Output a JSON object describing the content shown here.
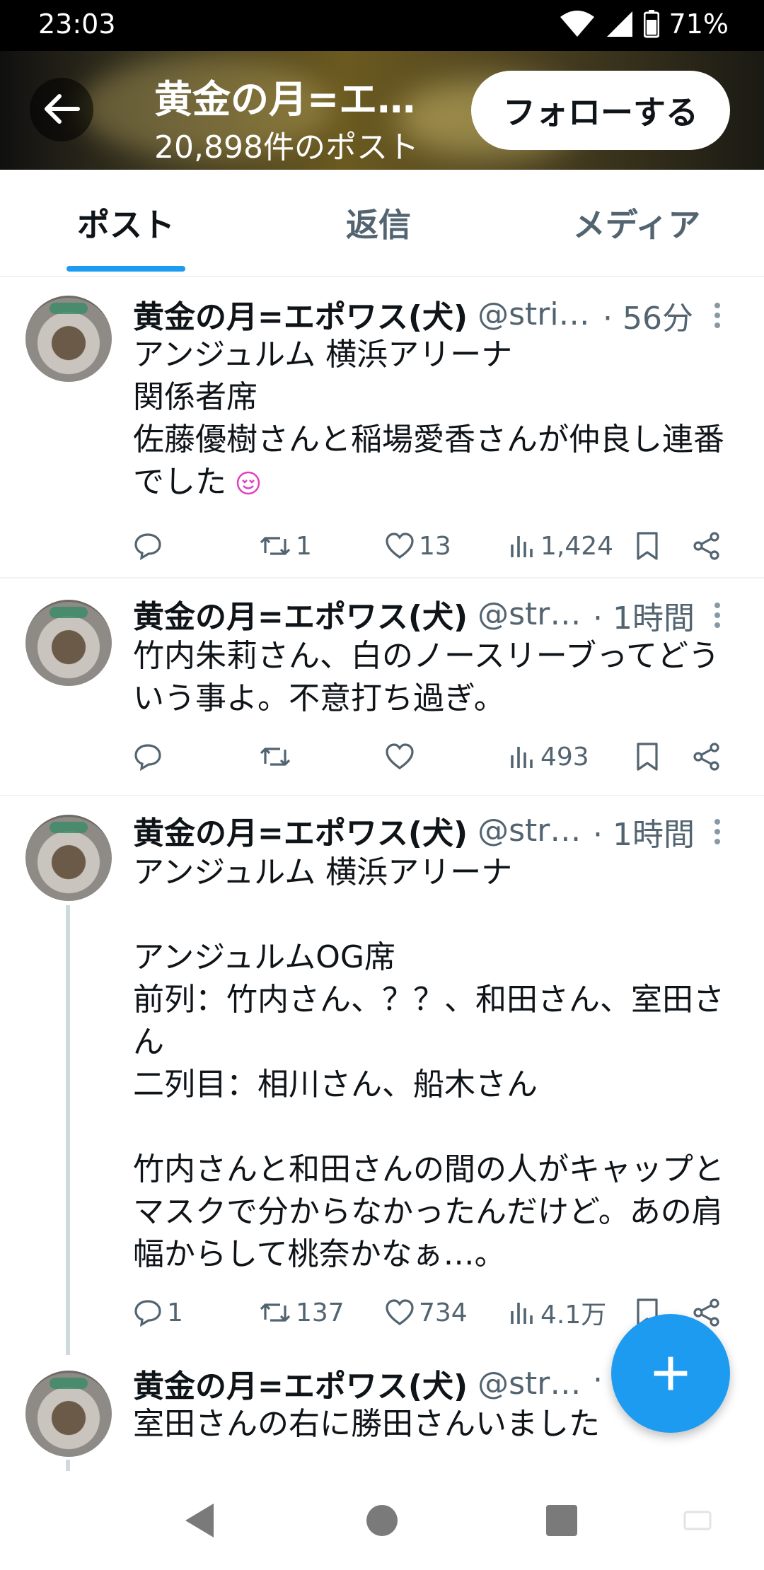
{
  "status_bar": {
    "time": "23:03",
    "battery": "71%"
  },
  "header": {
    "title": "黄金の月=エ…",
    "post_count": "20,898件のポスト",
    "follow_label": "フォローする"
  },
  "tabs": [
    {
      "label": "ポスト",
      "active": true
    },
    {
      "label": "返信",
      "active": false
    },
    {
      "label": "メディア",
      "active": false
    }
  ],
  "tweets": [
    {
      "name": "黄金の月=エポワス(犬)",
      "handle": "@strik…",
      "time": "· 56分",
      "body": "アンジュルム 横浜アリーナ\n関係者席\n佐藤優樹さんと稲場愛香さんが仲良し連番\nでした",
      "reply_count": "",
      "retweet_count": "1",
      "like_count": "13",
      "view_count": "1,424"
    },
    {
      "name": "黄金の月=エポワス(犬)",
      "handle": "@stri…",
      "time": "· 1時間",
      "body": "竹内朱莉さん、白のノースリーブってどう\nいう事よ。不意打ち過ぎ。",
      "reply_count": "",
      "retweet_count": "",
      "like_count": "",
      "view_count": "493"
    },
    {
      "name": "黄金の月=エポワス(犬)",
      "handle": "@stri…",
      "time": "· 1時間",
      "body": "アンジュルム 横浜アリーナ\n\nアンジュルムOG席\n前列：竹内さん、？？、和田さん、室田さ\nん\n二列目：相川さん、船木さん\n\n竹内さんと和田さんの間の人がキャップと\nマスクで分からなかったんだけど。あの肩\n幅からして桃奈かなぁ…。",
      "reply_count": "1",
      "retweet_count": "137",
      "like_count": "734",
      "view_count": "4.1万"
    },
    {
      "name": "黄金の月=エポワス(犬)",
      "handle": "@stri…",
      "time": "·",
      "body": "室田さんの右に勝田さんいました"
    }
  ],
  "fab": {
    "label": "+"
  },
  "colors": {
    "accent": "#1d9bf0",
    "secondary_text": "#536471",
    "emoji": "#e040c0"
  }
}
